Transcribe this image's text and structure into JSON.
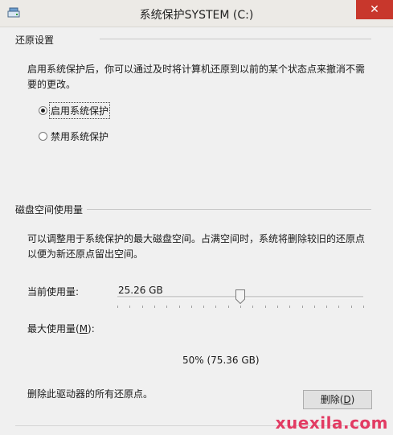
{
  "window": {
    "title": "系统保护SYSTEM (C:)",
    "close_glyph": "✕"
  },
  "restore_settings": {
    "heading": "还原设置",
    "description": "启用系统保护后，你可以通过及时将计算机还原到以前的某个状态点来撤消不需要的更改。",
    "options": [
      {
        "label": "启用系统保护",
        "selected": true
      },
      {
        "label": "禁用系统保护",
        "selected": false
      }
    ]
  },
  "disk_usage": {
    "heading": "磁盘空间使用量",
    "description": "可以调整用于系统保护的最大磁盘空间。占满空间时，系统将删除较旧的还原点以便为新还原点留出空间。",
    "current_label": "当前使用量:",
    "current_value": "25.26 GB",
    "max_label_prefix": "最大使用量(",
    "max_label_key": "M",
    "max_label_suffix": "):",
    "max_fraction": 0.5,
    "max_readout": "50% (75.36 GB)",
    "delete_text": "删除此驱动器的所有还原点。",
    "delete_button_prefix": "删除(",
    "delete_button_key": "D",
    "delete_button_suffix": ")"
  },
  "watermark": "xuexila.com",
  "icons": {
    "app": "drive-icon",
    "close": "close-icon"
  }
}
